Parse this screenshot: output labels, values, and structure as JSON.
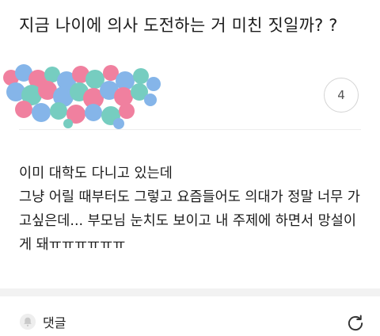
{
  "post": {
    "title": "지금 나이에 의사 도전하는 거 미친 짓일까? ?",
    "count": "4",
    "body": "이미 대학도 다니고 있는데\n그냥 어릴 때부터도 그렇고 요즘들어도 의대가 정말 너무 가고싶은데... 부모님 눈치도 보이고 내 주제에 하면서 망설이게 돼ㅠㅠㅠㅠㅠㅠ"
  },
  "footer": {
    "comment_label": "댓글"
  },
  "icons": {
    "comment": "bell-icon",
    "refresh": "refresh-icon"
  },
  "colors": {
    "blur_pink": "#f07a9a",
    "blur_blue": "#7fb2e8",
    "blur_teal": "#6fcbbd",
    "band": "#f2f2f2"
  }
}
